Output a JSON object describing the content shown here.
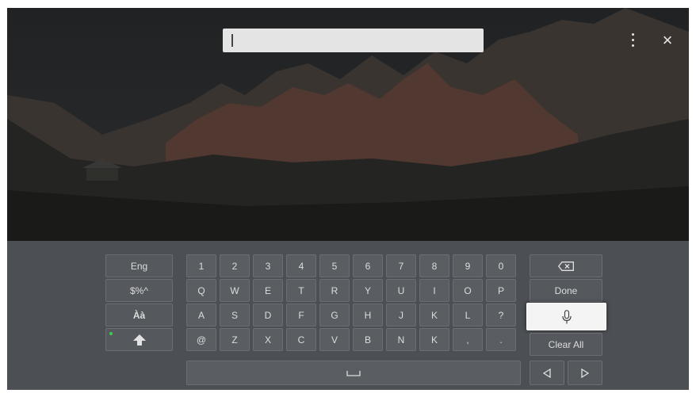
{
  "search": {
    "value": ""
  },
  "top_controls": {
    "menu_icon": "vertical-dots",
    "close_icon": "close-x"
  },
  "keyboard": {
    "left_keys": [
      {
        "label": "Eng",
        "name": "key-language"
      },
      {
        "label": "$%^",
        "name": "key-symbols"
      },
      {
        "label": "Àà",
        "name": "key-accents"
      },
      {
        "label": "",
        "name": "key-shift"
      }
    ],
    "rows": [
      [
        "1",
        "2",
        "3",
        "4",
        "5",
        "6",
        "7",
        "8",
        "9",
        "0"
      ],
      [
        "Q",
        "W",
        "E",
        "T",
        "R",
        "Y",
        "U",
        "I",
        "O",
        "P"
      ],
      [
        "A",
        "S",
        "D",
        "F",
        "G",
        "H",
        "J",
        "K",
        "L",
        "?"
      ],
      [
        "@",
        "Z",
        "X",
        "C",
        "V",
        "B",
        "N",
        "K",
        ",",
        "."
      ]
    ],
    "right_keys": {
      "backspace_icon": "backspace-icon",
      "done": "Done",
      "mic_icon": "microphone-icon",
      "clear_all": "Clear All"
    },
    "space_icon": "space-icon",
    "arrow_left_icon": "triangle-left-icon",
    "arrow_right_icon": "triangle-right-icon",
    "shift_indicator_color": "#3ccf4e"
  }
}
